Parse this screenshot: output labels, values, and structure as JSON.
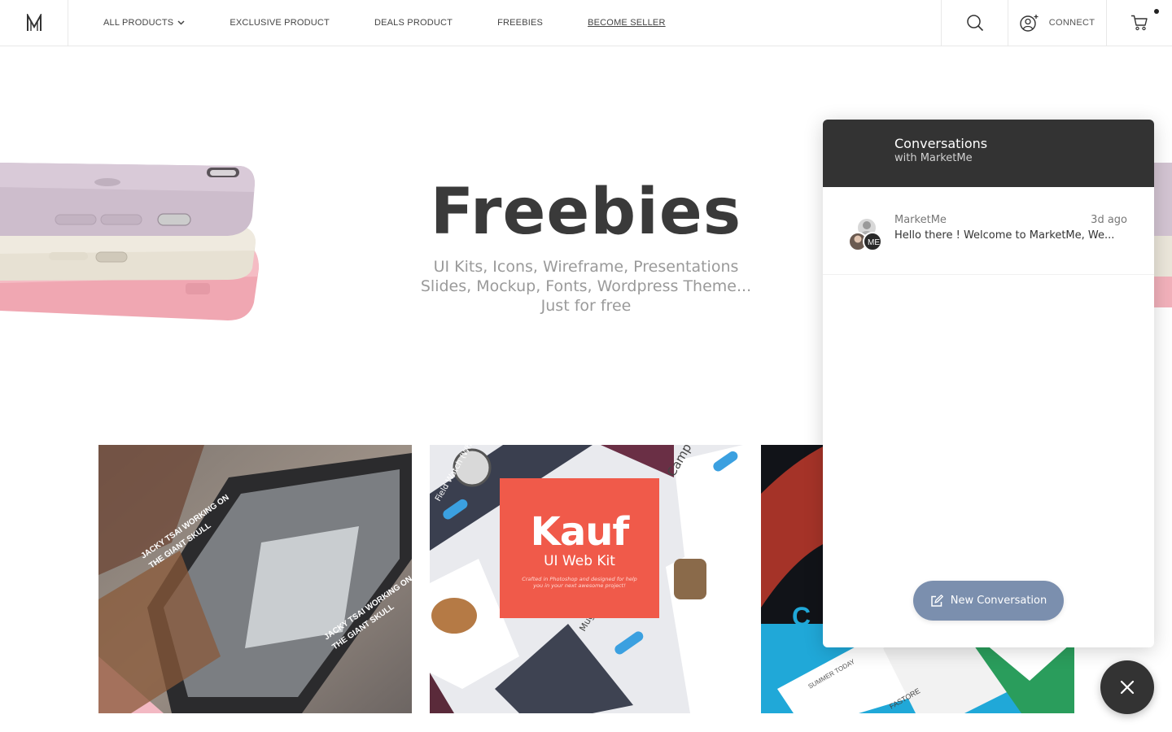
{
  "header": {
    "logo_letter": "M",
    "nav": [
      {
        "label": "ALL PRODUCTS",
        "has_dropdown": true
      },
      {
        "label": "EXCLUSIVE PRODUCT"
      },
      {
        "label": "DEALS PRODUCT"
      },
      {
        "label": "FREEBIES"
      },
      {
        "label": "BECOME SELLER",
        "underlined": true
      }
    ],
    "connect_label": "CONNECT",
    "icons": [
      "search-icon",
      "user-add-icon",
      "cart-icon"
    ]
  },
  "hero": {
    "title": "Freebies",
    "subtitle_lines": [
      "UI Kits, Icons, Wireframe, Presentations",
      "Slides, Mockup, Fonts, Wordpress Theme...",
      "Just for free"
    ]
  },
  "cards": [
    {
      "name": "news-app-mockup",
      "overlay_texts": [
        "JACKY TSAI WORKING ON",
        "THE GIANT SKULL"
      ]
    },
    {
      "name": "kauf-ui-kit",
      "brand": "Kauf",
      "subtitle": "UI Web Kit",
      "tagline": "Crafted in Photoshop and designed for help you in your next awesome project!",
      "overlay_texts": [
        "Camp & Suede Backpack",
        "Field Watch (White Dial)",
        "Mug Shaving"
      ]
    },
    {
      "name": "fastore-mockup",
      "overlay_texts": [
        "C",
        "SUMMER TODAY",
        "FASTORE"
      ]
    }
  ],
  "chat": {
    "title": "Conversations",
    "subtitle": "with MarketMe",
    "conversations": [
      {
        "name": "MarketMe",
        "time": "3d ago",
        "preview": "Hello there ! Welcome to MarketMe, We..."
      }
    ],
    "new_conversation_label": "New Conversation"
  },
  "colors": {
    "chat_header": "#333333",
    "new_convo_button": "#7b8fae",
    "kauf_red": "#f05a4a",
    "text_dark": "#3a3a3a",
    "text_muted": "#9a9a9a"
  }
}
